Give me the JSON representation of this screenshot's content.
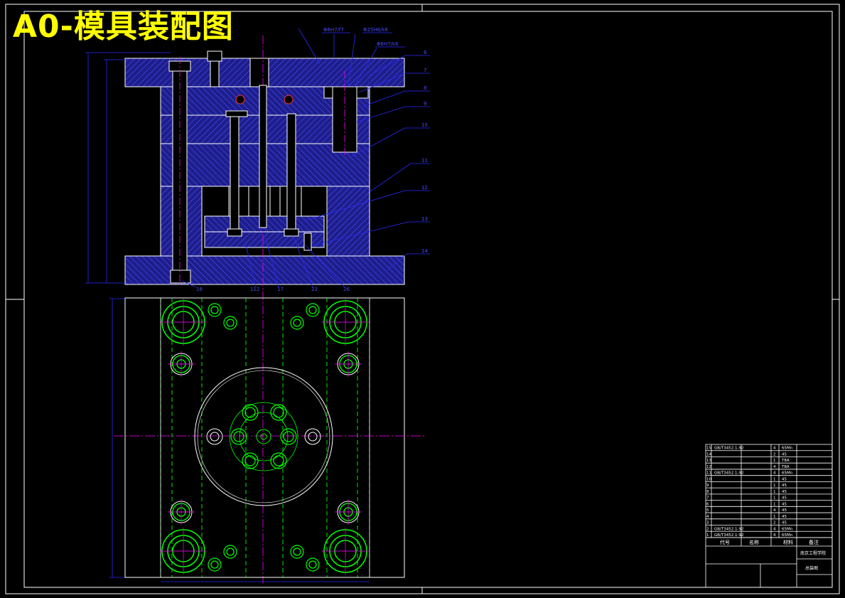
{
  "drawing": {
    "title": "A0-模具装配图",
    "fits": [
      "Φ6H7/f7",
      "Φ25H6/k6",
      "Φ6H7/k6"
    ],
    "balloons_right": [
      "6",
      "7",
      "8",
      "9",
      "10",
      "11",
      "12",
      "13",
      "14"
    ],
    "balloons_bottom": [
      "18",
      "112",
      "17",
      "22",
      "26"
    ]
  },
  "bom": {
    "rows": [
      {
        "no": "15",
        "code": "GB/T3452.1-92",
        "name": "",
        "qty": "4",
        "material": "65Mn"
      },
      {
        "no": "14",
        "code": "",
        "name": "",
        "qty": "2",
        "material": "45"
      },
      {
        "no": "13",
        "code": "",
        "name": "",
        "qty": "1",
        "material": "T8A"
      },
      {
        "no": "12",
        "code": "",
        "name": "",
        "qty": "4",
        "material": "T8A"
      },
      {
        "no": "11",
        "code": "GB/T3452.1-92",
        "name": "",
        "qty": "4",
        "material": "65Mn"
      },
      {
        "no": "10",
        "code": "",
        "name": "",
        "qty": "1",
        "material": "45"
      },
      {
        "no": "9",
        "code": "",
        "name": "",
        "qty": "1",
        "material": "45"
      },
      {
        "no": "8",
        "code": "",
        "name": "",
        "qty": "1",
        "material": "45"
      },
      {
        "no": "7",
        "code": "",
        "name": "",
        "qty": "1",
        "material": "45"
      },
      {
        "no": "6",
        "code": "",
        "name": "",
        "qty": "1",
        "material": "45"
      },
      {
        "no": "5",
        "code": "",
        "name": "",
        "qty": "4",
        "material": "45"
      },
      {
        "no": "4",
        "code": "",
        "name": "",
        "qty": "1",
        "material": "45"
      },
      {
        "no": "3",
        "code": "",
        "name": "",
        "qty": "2",
        "material": "45"
      },
      {
        "no": "2",
        "code": "GB/T3452.1-92",
        "name": "",
        "qty": "4",
        "material": "65Mn"
      },
      {
        "no": "1",
        "code": "GB/T3452.1-92",
        "name": "",
        "qty": "4",
        "material": "65Mn"
      }
    ],
    "header": {
      "code": "代号",
      "name": "名称",
      "material": "材料",
      "note": "备注"
    },
    "school": "南京工程学院",
    "drawing_name": "总装图"
  }
}
